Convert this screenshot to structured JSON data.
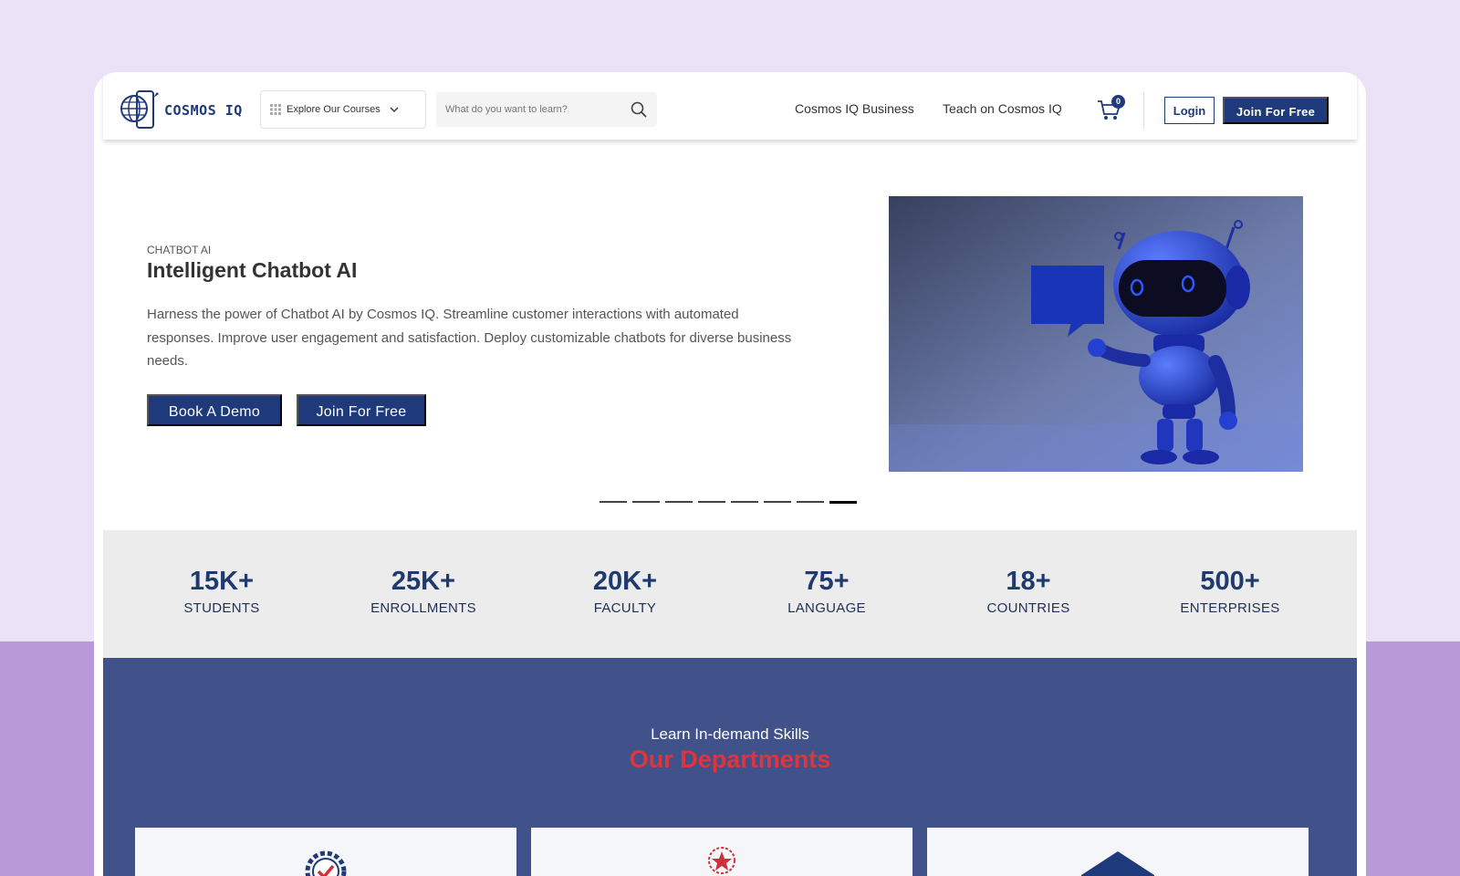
{
  "header": {
    "logo_text": "COSMOS IQ",
    "explore_label": "Explore Our Courses",
    "search_placeholder": "What do you want to learn?",
    "links": [
      "Cosmos IQ Business",
      "Teach on Cosmos IQ"
    ],
    "cart_count": "0",
    "login_label": "Login",
    "join_label": "Join For Free"
  },
  "hero": {
    "kicker": "CHATBOT AI",
    "title": "Intelligent Chatbot AI",
    "description": "Harness the power of Chatbot AI by Cosmos IQ. Streamline customer interactions with automated responses. Improve user engagement and satisfaction. Deploy customizable chatbots for diverse business needs.",
    "demo_label": "Book A Demo",
    "join_label": "Join For Free",
    "slide_count": 8,
    "active_slide": 8
  },
  "stats": [
    {
      "value": "15K+",
      "label": "STUDENTS"
    },
    {
      "value": "25K+",
      "label": "ENROLLMENTS"
    },
    {
      "value": "20K+",
      "label": "FACULTY"
    },
    {
      "value": "75+",
      "label": "LANGUAGE"
    },
    {
      "value": "18+",
      "label": "COUNTRIES"
    },
    {
      "value": "500+",
      "label": "ENTERPRISES"
    }
  ],
  "departments": {
    "kicker": "Learn In-demand Skills",
    "title": "Our Departments"
  },
  "colors": {
    "brand_navy": "#1f3a7a",
    "accent_red": "#e0343c",
    "dept_bg": "#41528a"
  }
}
